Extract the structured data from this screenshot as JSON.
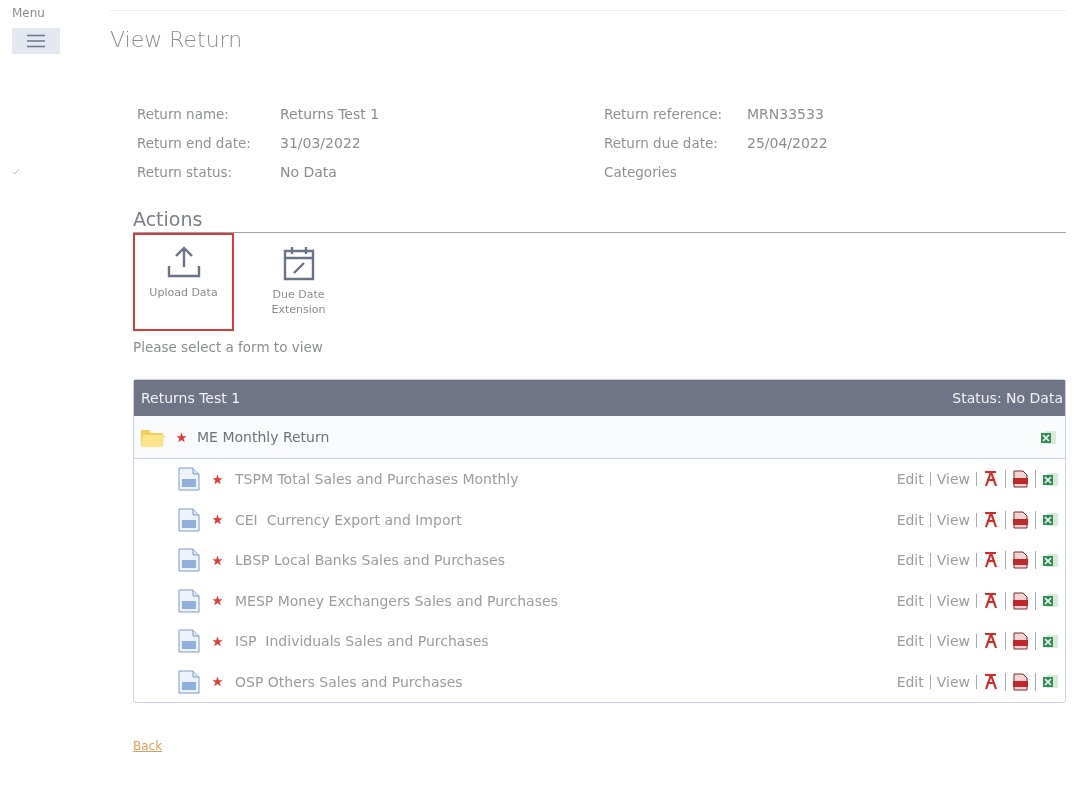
{
  "menu": {
    "label": "Menu"
  },
  "page_title": "View Return",
  "details_left": [
    {
      "label": "Return name:",
      "value": "Returns Test 1"
    },
    {
      "label": "Return end date:",
      "value": "31/03/2022"
    },
    {
      "label": "Return status:",
      "value": "No Data"
    }
  ],
  "details_right": [
    {
      "label": "Return reference:",
      "value": "MRN33533"
    },
    {
      "label": "Return due date:",
      "value": "25/04/2022"
    },
    {
      "label": "Categories"
    }
  ],
  "actions_heading": "Actions",
  "actions": [
    {
      "kind": "upload",
      "label": "Upload Data",
      "selected": true
    },
    {
      "kind": "calendar",
      "label": "Due Date Extension",
      "selected": false
    }
  ],
  "prompt": "Please select a form to view",
  "table": {
    "title": "Returns Test 1",
    "status": "Status: No Data",
    "group": {
      "name": "ME Monthly Return",
      "required": true
    },
    "rows": [
      {
        "name": "TSPM Total Sales and Purchases Monthly",
        "required": true,
        "edit": "Edit",
        "view": "View"
      },
      {
        "name": "CEI  Currency Export and Import",
        "required": true,
        "edit": "Edit",
        "view": "View"
      },
      {
        "name": "LBSP Local Banks Sales and Purchases",
        "required": true,
        "edit": "Edit",
        "view": "View"
      },
      {
        "name": "MESP Money Exchangers Sales and Purchases",
        "required": true,
        "edit": "Edit",
        "view": "View"
      },
      {
        "name": "ISP  Individuals Sales and Purchases",
        "required": true,
        "edit": "Edit",
        "view": "View"
      },
      {
        "name": "OSP Others Sales and Purchases",
        "required": true,
        "edit": "Edit",
        "view": "View"
      }
    ]
  },
  "back_link": "Back"
}
